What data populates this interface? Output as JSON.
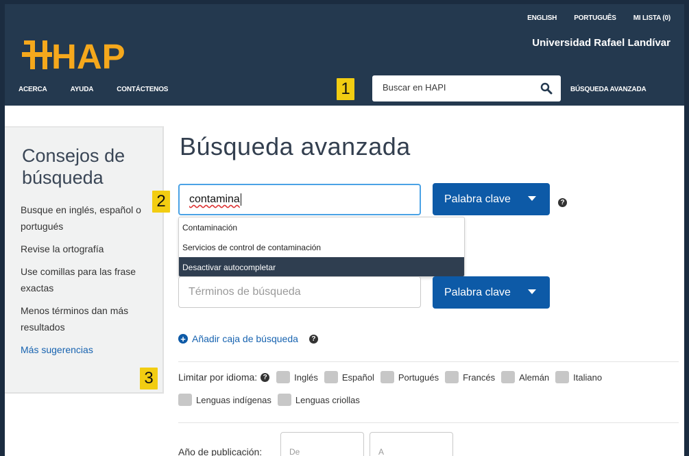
{
  "header": {
    "top_links": [
      "ENGLISH",
      "PORTUGUÊS",
      "MI LISTA (0)"
    ],
    "institution": "Universidad Rafael Landívar",
    "logo_text": "HAPI",
    "nav": [
      "ACERCA",
      "AYUDA",
      "CONTÁCTENOS"
    ],
    "search_placeholder": "Buscar en HAPI",
    "advanced_link": "BÚSQUEDA AVANZADA"
  },
  "badges": [
    "1",
    "2",
    "3"
  ],
  "sidebar": {
    "title": "Consejos de búsqueda",
    "tips": [
      "Busque en inglés, español o portugués",
      "Revise la ortografía",
      "Use comillas para las frase exactas",
      "Menos términos dan más resultados"
    ],
    "more_link": "Más sugerencias"
  },
  "main": {
    "title": "Búsqueda avanzada",
    "search_row_1": {
      "value": "contamina",
      "field_type": "Palabra clave"
    },
    "autocomplete": [
      "Contaminación",
      "Servicios de control de contaminación",
      "Desactivar autocompletar"
    ],
    "search_row_2": {
      "placeholder": "Términos de búsqueda",
      "field_type": "Palabra clave"
    },
    "add_box_label": "Añadir caja de búsqueda",
    "language_filter": {
      "label": "Limitar por idioma:",
      "options": [
        "Inglés",
        "Español",
        "Portugués",
        "Francés",
        "Alemán",
        "Italiano",
        "Lenguas indígenas",
        "Lenguas criollas"
      ]
    },
    "year": {
      "label": "Año de publicación:",
      "from_placeholder": "De",
      "to_placeholder": "A"
    }
  },
  "colors": {
    "header_bg": "#24394f",
    "logo": "#f5a81c",
    "button": "#0d5aa7",
    "badge": "#f2cd12",
    "link": "#1763b0"
  }
}
